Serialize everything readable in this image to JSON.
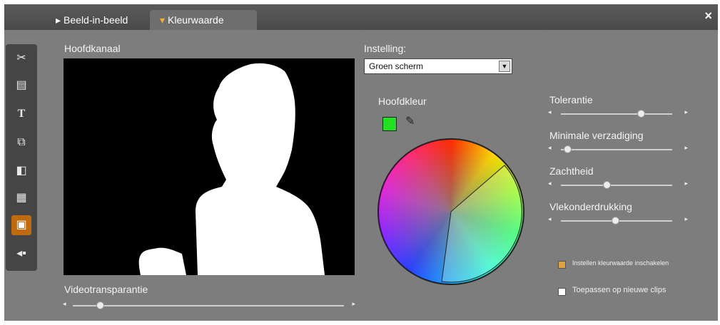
{
  "tabs": [
    {
      "label": "Beeld-in-beeld"
    },
    {
      "label": "Kleurwaarde"
    }
  ],
  "close_icon": "×",
  "tools": [
    "scissors-icon",
    "title-icon",
    "text-icon",
    "transition-icon",
    "camera-icon",
    "clip-icon",
    "chroma-key-icon",
    "audio-icon"
  ],
  "main_channel": {
    "label": "Hoofdkanaal"
  },
  "video_transparency": {
    "label": "Videotransparantie",
    "value": 0.1
  },
  "setting": {
    "label": "Instelling:",
    "selected": "Groen scherm"
  },
  "key_color": {
    "label": "Hoofdkleur",
    "color": "#22e022"
  },
  "sliders": [
    {
      "label": "Tolerantie",
      "value": 0.72
    },
    {
      "label": "Minimale verzadiging",
      "value": 0.06
    },
    {
      "label": "Zachtheid",
      "value": 0.41
    },
    {
      "label": "Vlekonderdrukking",
      "value": 0.49
    }
  ],
  "options": [
    {
      "label": "Instellen kleurwaarde inschakelen",
      "checked": true
    },
    {
      "label": "Toepassen op nieuwe clips",
      "checked": false
    }
  ]
}
